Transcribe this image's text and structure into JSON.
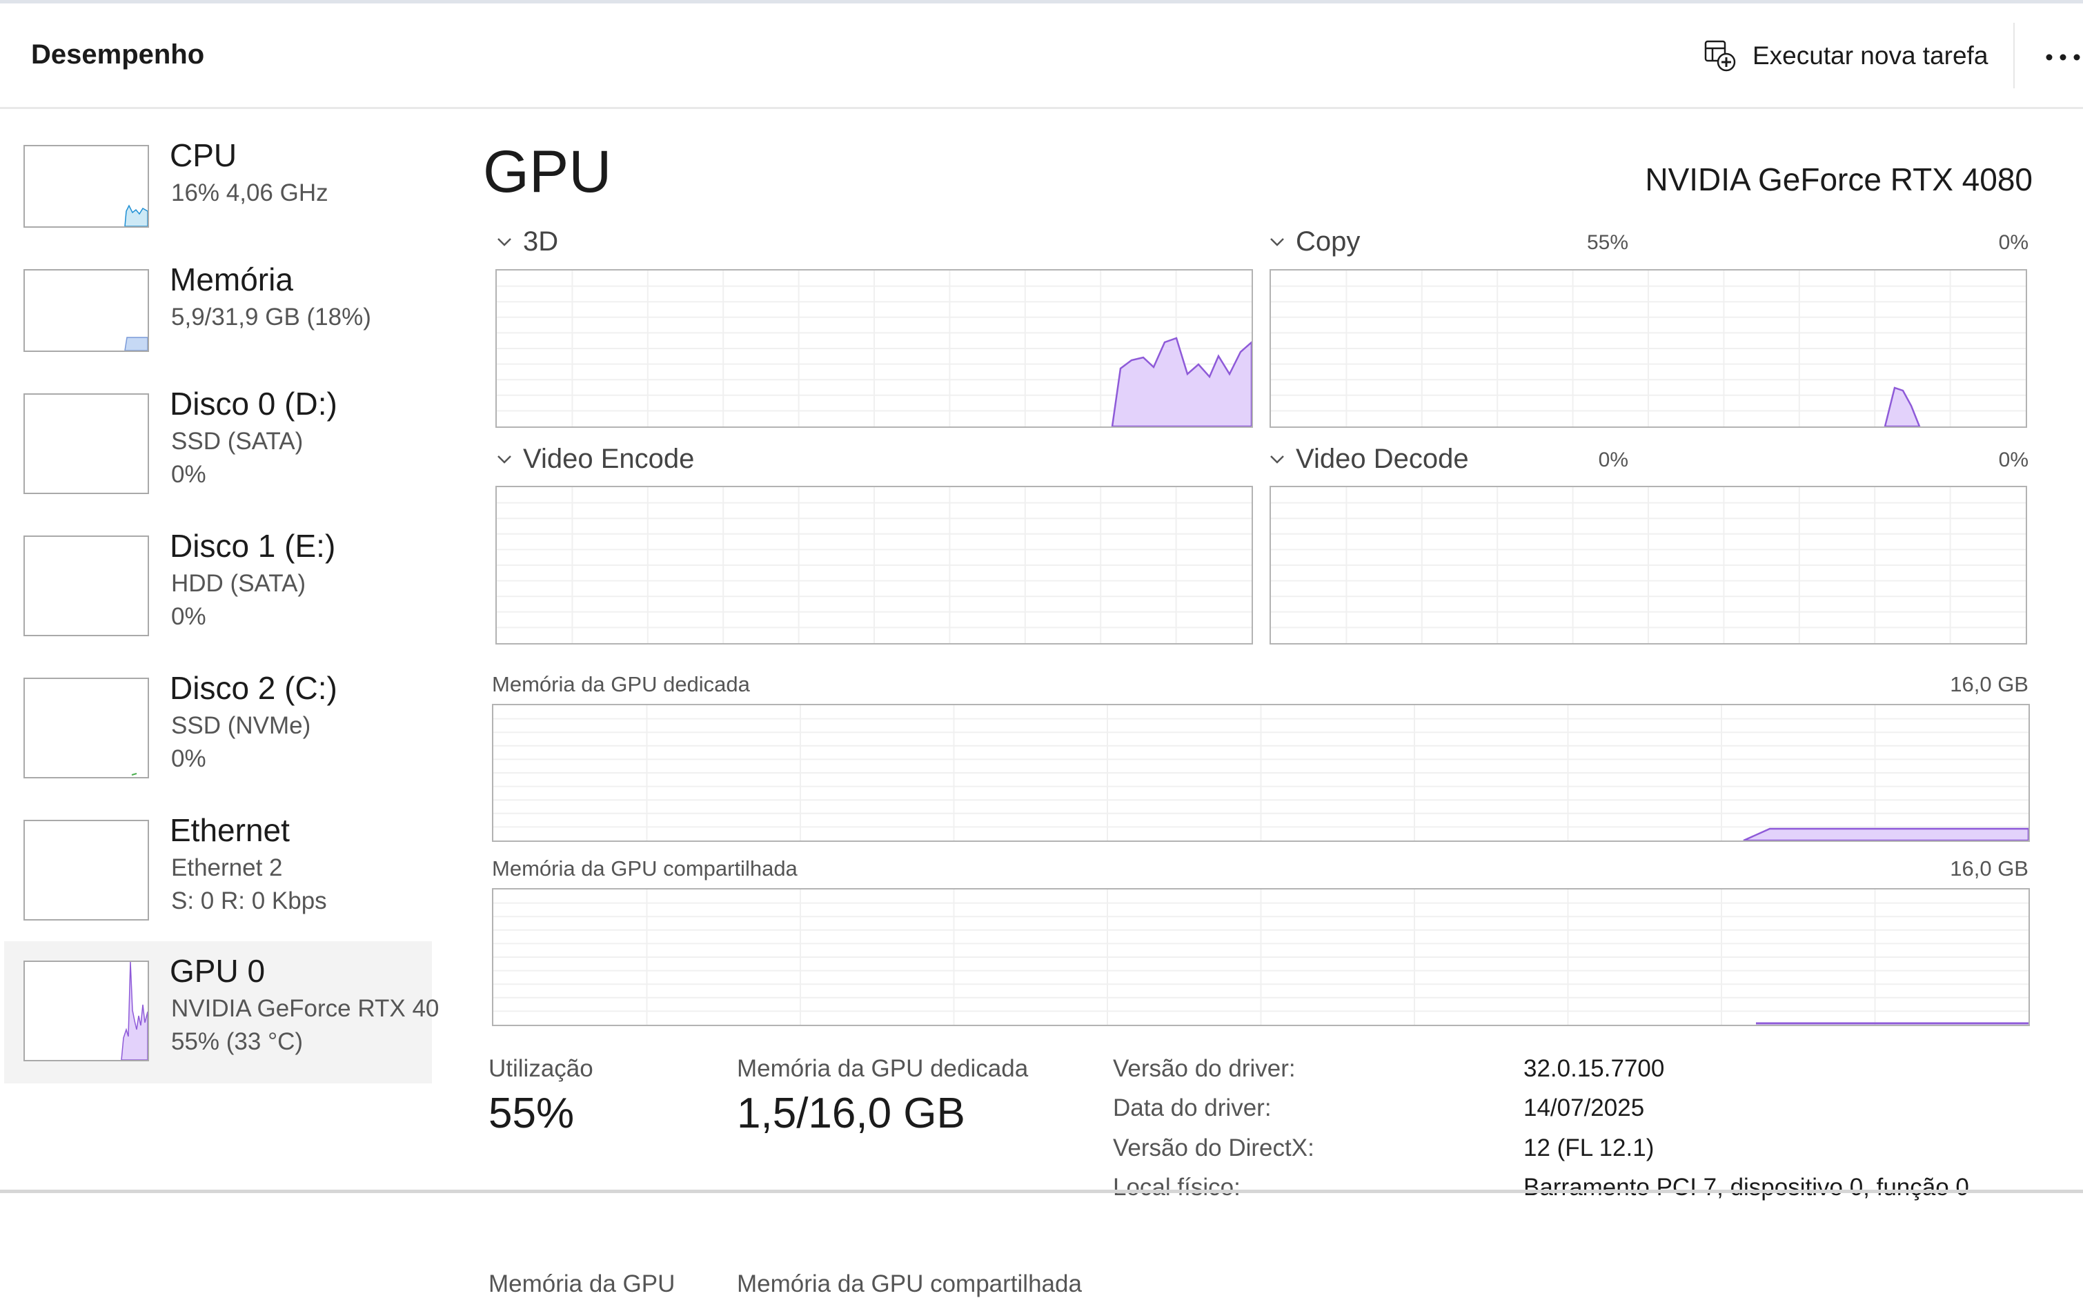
{
  "header": {
    "title": "Desempenho",
    "run_task_label": "Executar nova tarefa",
    "more_label": "⋯"
  },
  "sidebar": {
    "items": [
      {
        "title": "CPU",
        "line1": "16%  4,06 GHz",
        "line2": "",
        "graph_color": "#1e8fd4",
        "fill": "#cde9f6"
      },
      {
        "title": "Memória",
        "line1": "5,9/31,9 GB (18%)",
        "line2": "",
        "graph_color": "#7a5ab8",
        "fill": "#c6d9f5"
      },
      {
        "title": "Disco 0 (D:)",
        "line1": "SSD (SATA)",
        "line2": "0%",
        "graph_color": "#4caf50",
        "fill": "#e6f4e6"
      },
      {
        "title": "Disco 1 (E:)",
        "line1": "HDD (SATA)",
        "line2": "0%",
        "graph_color": "#4caf50",
        "fill": "#e6f4e6"
      },
      {
        "title": "Disco 2 (C:)",
        "line1": "SSD (NVMe)",
        "line2": "0%",
        "graph_color": "#4caf50",
        "fill": "#e6f4e6"
      },
      {
        "title": "Ethernet",
        "line1": "Ethernet 2",
        "line2": "S: 0 R: 0 Kbps",
        "graph_color": "#b8860b",
        "fill": "#f5ead0"
      },
      {
        "title": "GPU 0",
        "line1": "NVIDIA GeForce RTX 40",
        "line2": "55% (33 °C)",
        "graph_color": "#8e5ad8",
        "fill": "#e3d2fb"
      }
    ]
  },
  "gpu": {
    "title": "GPU",
    "model": "NVIDIA GeForce RTX 4080",
    "accent": "#8e5ad8",
    "fill": "#e3d2fb",
    "engines": [
      {
        "name": "3D",
        "value": "55%"
      },
      {
        "name": "Copy",
        "value": "0%"
      },
      {
        "name": "Video Encode",
        "value": "0%"
      },
      {
        "name": "Video Decode",
        "value": "0%"
      }
    ],
    "dedicated_memory": {
      "label": "Memória da GPU dedicada",
      "max": "16,0 GB"
    },
    "shared_memory": {
      "label": "Memória da GPU compartilhada",
      "max": "16,0 GB"
    }
  },
  "stats": {
    "utilization_label": "Utilização",
    "utilization_value": "55%",
    "dedicated_label": "Memória da GPU dedicada",
    "dedicated_value": "1,5/16,0 GB",
    "gpu_memory_label": "Memória da GPU",
    "shared_label": "Memória da GPU compartilhada"
  },
  "properties": [
    {
      "label": "Versão do driver:",
      "value": "32.0.15.7700"
    },
    {
      "label": "Data do driver:",
      "value": "14/07/2025"
    },
    {
      "label": "Versão do DirectX:",
      "value": "12 (FL 12.1)"
    },
    {
      "label": "Local físico:",
      "value": "Barramento PCI 7, dispositivo 0, função 0"
    }
  ]
}
